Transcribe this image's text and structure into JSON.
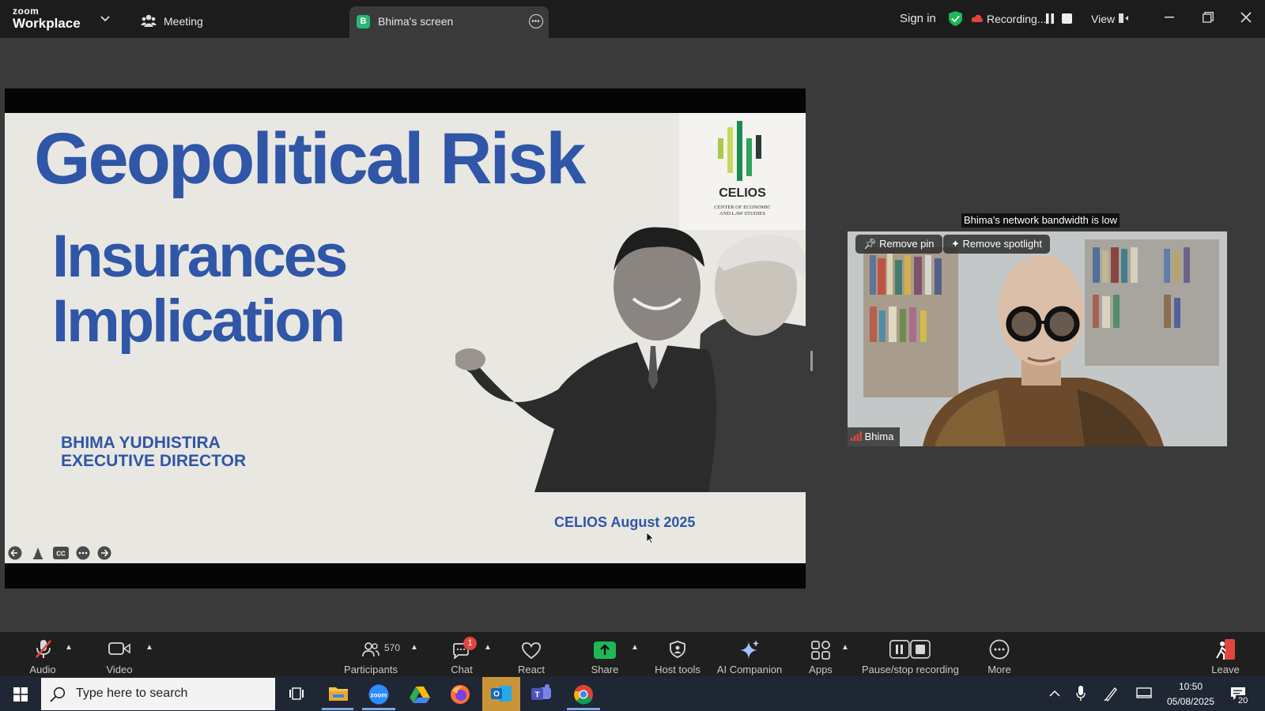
{
  "titlebar": {
    "brand_top": "zoom",
    "brand_bottom": "Workplace",
    "meeting_tab": "Meeting",
    "screen_badge": "B",
    "screen_tab": "Bhima's screen",
    "sign_in": "Sign in",
    "recording": "Recording...",
    "view": "View"
  },
  "slide": {
    "title": "Geopolitical Risk",
    "line1": "Insurances",
    "line2": "Implication",
    "presenter_name": "BHIMA YUDHISTIRA",
    "presenter_role": "EXECUTIVE DIRECTOR",
    "logo_name": "CELIOS",
    "logo_tagline_1": "CENTER OF ECONOMIC",
    "logo_tagline_2": "AND LAW STUDIES",
    "footer": "CELIOS August 2025"
  },
  "video": {
    "bandwidth_notice": "Bhima's network bandwidth is low",
    "remove_pin": "Remove pin",
    "remove_spotlight": "Remove spotlight",
    "participant_name": "Bhima"
  },
  "toolbar": {
    "audio": "Audio",
    "video": "Video",
    "participants": "Participants",
    "participants_count": "570",
    "chat": "Chat",
    "chat_badge": "1",
    "react": "React",
    "share": "Share",
    "host_tools": "Host tools",
    "ai_companion": "AI Companion",
    "apps": "Apps",
    "pause_stop": "Pause/stop recording",
    "more": "More",
    "leave": "Leave"
  },
  "taskbar": {
    "search_placeholder": "Type here to search",
    "time": "10:50",
    "date": "05/08/2025",
    "notifications": "20"
  },
  "colors": {
    "slide_blue": "#2f56a7",
    "share_green": "#1db954",
    "record_red": "#e2453c"
  }
}
